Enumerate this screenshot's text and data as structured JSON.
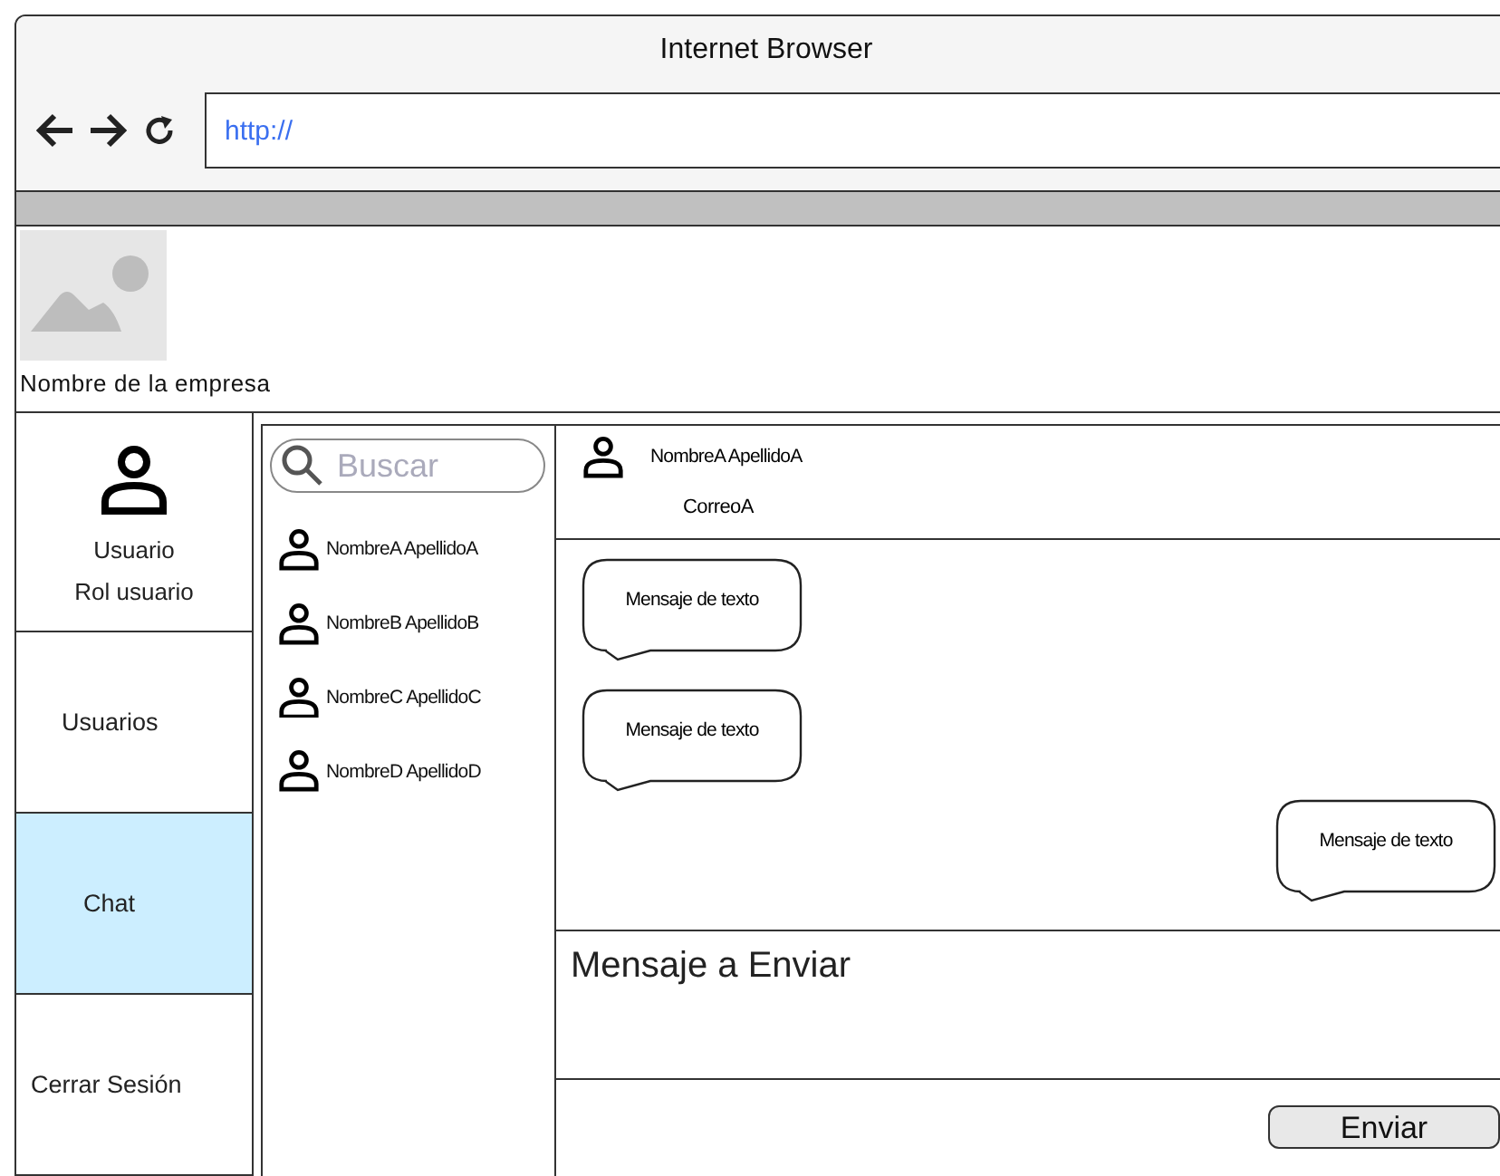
{
  "window": {
    "title": "Internet Browser",
    "address": "http://"
  },
  "header": {
    "company_name": "Nombre de la empresa"
  },
  "sidebar": {
    "user": {
      "name": "Usuario",
      "role": "Rol usuario"
    },
    "items": [
      {
        "label": "Usuarios",
        "selected": false
      },
      {
        "label": "Chat",
        "selected": true
      },
      {
        "label": "Cerrar Sesión",
        "selected": false
      }
    ]
  },
  "contacts": {
    "search": {
      "placeholder": "Buscar"
    },
    "items": [
      {
        "name": "NombreA ApellidoA"
      },
      {
        "name": "NombreB ApellidoB"
      },
      {
        "name": "NombreC ApellidoC"
      },
      {
        "name": "NombreD ApellidoD"
      }
    ]
  },
  "chat": {
    "contact": {
      "name": "NombreA ApellidoA",
      "email": "CorreoA"
    },
    "messages": [
      {
        "text": "Mensaje de texto",
        "kind": "received"
      },
      {
        "text": "Mensaje de texto",
        "kind": "received"
      },
      {
        "text": "Mensaje de texto",
        "kind": "sent"
      }
    ],
    "compose": {
      "value": "Mensaje a Enviar"
    },
    "send_button": "Enviar"
  }
}
